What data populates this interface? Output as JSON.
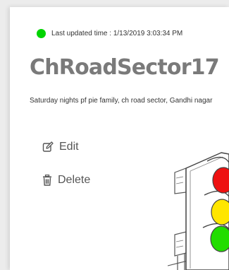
{
  "status": {
    "indicator_color": "#00d400",
    "text": "Last updated time : 1/13/2019 3:03:34 PM"
  },
  "sector": {
    "name": "ChRoadSector17",
    "address": "Saturday nights pf pie family, ch road sector, Gandhi nagar"
  },
  "actions": {
    "edit_icon": "edit-icon",
    "edit_label": "Edit",
    "delete_icon": "trash-icon",
    "delete_label": "Delete"
  },
  "illustration": {
    "icon": "traffic-light-icon",
    "colors": {
      "red": "#ee1111",
      "yellow": "#ffe600",
      "green": "#22dd00"
    }
  }
}
